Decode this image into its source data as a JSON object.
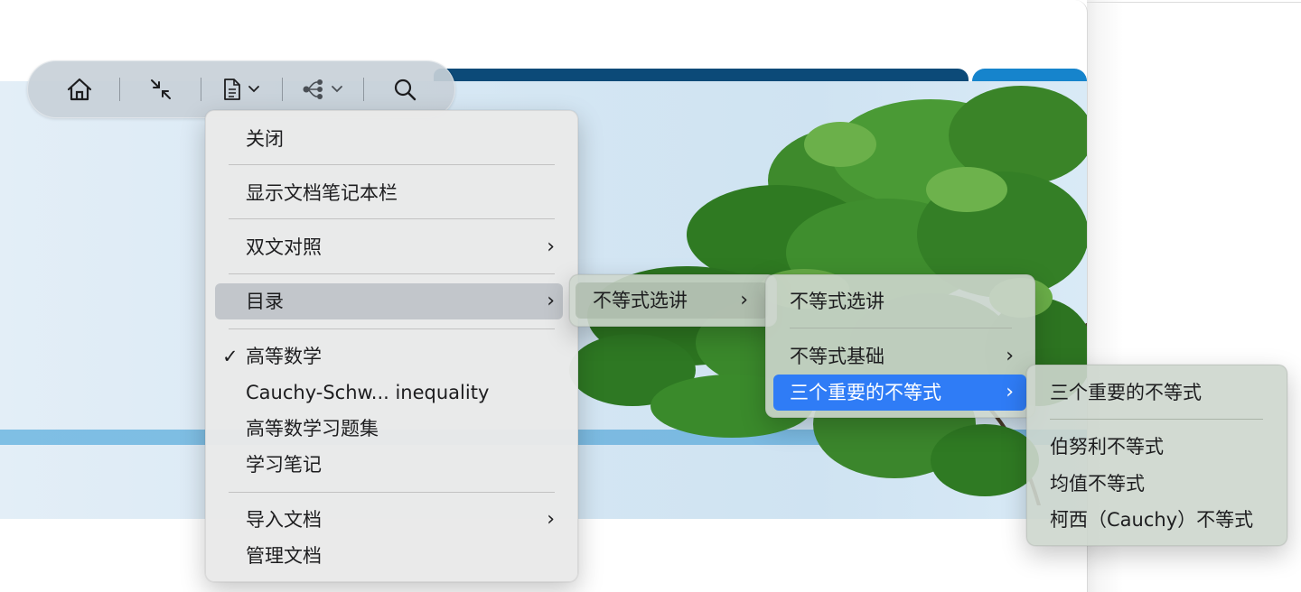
{
  "toolbar": {
    "buttons": [
      {
        "icon": "home-icon"
      },
      {
        "icon": "collapse-icon"
      },
      {
        "icon": "document-menu-icon",
        "dropdown": true
      },
      {
        "icon": "mindmap-icon",
        "dropdown": true
      },
      {
        "icon": "search-icon"
      }
    ]
  },
  "menu_main": {
    "close": "关闭",
    "show_notebook_bar": "显示文档笔记本栏",
    "bilingual": "双文对照",
    "toc": "目录",
    "docs": [
      "高等数学",
      "Cauchy-Schw... inequality",
      "高等数学习题集",
      "学习笔记"
    ],
    "checked_doc": "高等数学",
    "import": "导入文档",
    "manage": "管理文档",
    "check_mark": "✓"
  },
  "menu_toc_lvl1": {
    "item": "不等式选讲"
  },
  "menu_toc_lvl2": {
    "header": "不等式选讲",
    "items": [
      "不等式基础",
      "三个重要的不等式"
    ]
  },
  "menu_toc_lvl3": {
    "header": "三个重要的不等式",
    "items": [
      "伯努利不等式",
      "均值不等式",
      "柯西（Cauchy）不等式"
    ]
  },
  "submenu_arrow": "›",
  "colors": {
    "highlight_blue": "#2f7cf6",
    "banner_navy": "#0c4a78",
    "banner_stripe": "#7fbfe4"
  }
}
